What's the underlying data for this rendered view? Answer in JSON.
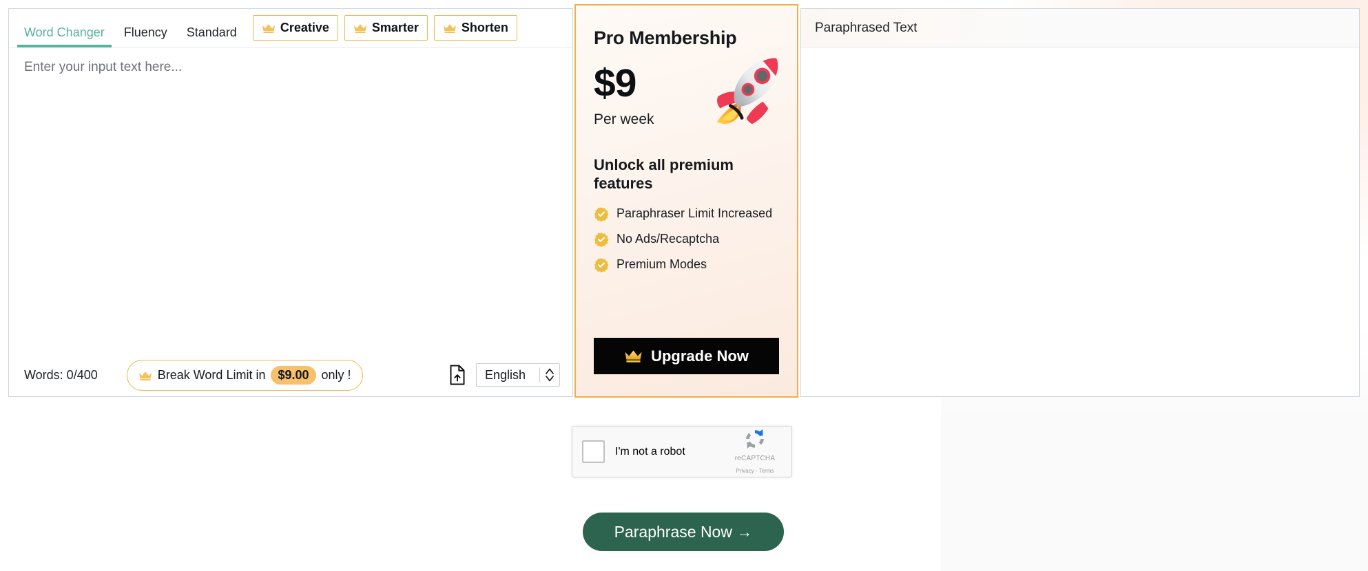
{
  "tabs": [
    {
      "label": "Word Changer",
      "active": true,
      "premium": false
    },
    {
      "label": "Fluency",
      "active": false,
      "premium": false
    },
    {
      "label": "Standard",
      "active": false,
      "premium": false
    },
    {
      "label": "Creative",
      "active": false,
      "premium": true
    },
    {
      "label": "Smarter",
      "active": false,
      "premium": true
    },
    {
      "label": "Shorten",
      "active": false,
      "premium": true
    }
  ],
  "editor": {
    "placeholder": "Enter your input text here...",
    "value": "",
    "word_count": "Words: 0/400",
    "limit_promo": {
      "prefix": "Break Word Limit in",
      "price": "$9.00",
      "suffix": "only !",
      "crown_icon": "crown-icon"
    },
    "upload_icon": "file-upload-icon",
    "language": {
      "selected": "English",
      "options": [
        "English"
      ],
      "chevron_icon": "chevron-up-down-icon"
    }
  },
  "pro": {
    "title": "Pro Membership",
    "price": "$9",
    "period": "Per week",
    "rocket_icon": "rocket-icon",
    "unlock_heading": "Unlock all premium features",
    "features": [
      "Paraphraser Limit Increased",
      "No Ads/Recaptcha",
      "Premium Modes"
    ],
    "feature_icon": "check-badge-icon",
    "upgrade_label": "Upgrade Now",
    "upgrade_crown_icon": "crown-icon"
  },
  "output": {
    "title": "Paraphrased Text",
    "value": ""
  },
  "recaptcha": {
    "label": "I'm not a robot",
    "brand": "reCAPTCHA",
    "legal": "Privacy - Terms",
    "logo_icon": "recaptcha-logo-icon",
    "checkbox_icon": "checkbox-icon"
  },
  "cta": {
    "label": "Paraphrase Now  →"
  },
  "colors": {
    "accent_teal": "#53b39d",
    "premium_gold": "#f0b84e",
    "crown_gold": "#f5c258",
    "price_pill": "#f7c06a",
    "cta_green": "#2d6450",
    "upgrade_black": "#050505",
    "panel_border": "#cdd5dc",
    "pro_border": "#f0ae4c"
  }
}
